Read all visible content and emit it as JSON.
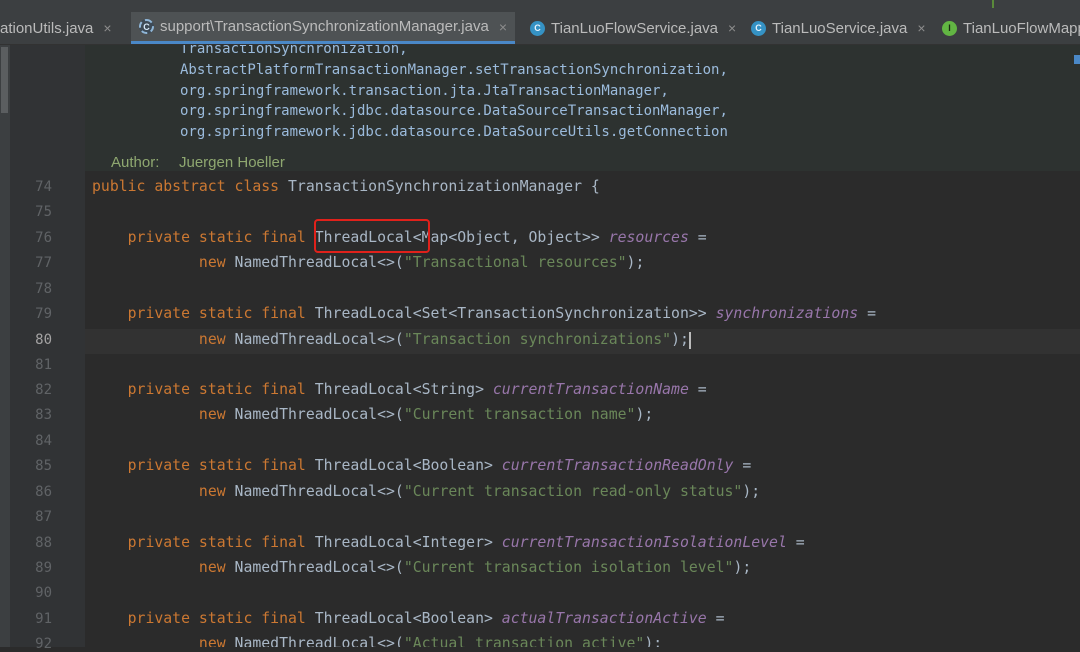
{
  "colors": {
    "keyword": "#cc7832",
    "field": "#9876aa",
    "string": "#6a8759",
    "plain": "#a9b7c6",
    "doc_link": "#9bbbdc",
    "doc_tag": "#8fa870",
    "highlight_box": "#e0211b",
    "active_tab_underline": "#4a88c7"
  },
  "tabs": [
    {
      "label": "ationUtils.java",
      "icon": "java-class-icon",
      "active": false
    },
    {
      "label": "support\\TransactionSynchronizationManager.java",
      "icon": "abstract-class-icon",
      "active": true
    },
    {
      "label": "TianLuoFlowService.java",
      "icon": "java-class-icon",
      "active": false
    },
    {
      "label": "TianLuoService.java",
      "icon": "java-class-icon",
      "active": false
    },
    {
      "label": "TianLuoFlowMapp",
      "icon": "interface-icon",
      "active": false
    }
  ],
  "tab_icon_letters": {
    "class": "C",
    "interface": "I"
  },
  "close_glyph": "×",
  "doc": {
    "lines": [
      "TransactionSynchronization,",
      "AbstractPlatformTransactionManager.setTransactionSynchronization,",
      "org.springframework.transaction.jta.JtaTransactionManager,",
      "org.springframework.jdbc.datasource.DataSourceTransactionManager,",
      "org.springframework.jdbc.datasource.DataSourceUtils.getConnection"
    ],
    "author_label": "Author:",
    "author_value": "Juergen Hoeller"
  },
  "current_line": "80",
  "code": [
    {
      "n": "74",
      "tokens": [
        [
          "kw",
          "public abstract class "
        ],
        [
          "p",
          "TransactionSynchronizationManager {"
        ]
      ]
    },
    {
      "n": "75",
      "tokens": []
    },
    {
      "n": "76",
      "tokens": [
        [
          "p",
          "    "
        ],
        [
          "kw",
          "private static final "
        ],
        [
          "p",
          "ThreadLocal<Map<Object, Object>> "
        ],
        [
          "fld",
          "resources"
        ],
        [
          "p",
          " ="
        ]
      ]
    },
    {
      "n": "77",
      "tokens": [
        [
          "p",
          "            "
        ],
        [
          "kw",
          "new "
        ],
        [
          "p",
          "NamedThreadLocal<>("
        ],
        [
          "str",
          "\"Transactional resources\""
        ],
        [
          "p",
          ");"
        ]
      ]
    },
    {
      "n": "78",
      "tokens": []
    },
    {
      "n": "79",
      "tokens": [
        [
          "p",
          "    "
        ],
        [
          "kw",
          "private static final "
        ],
        [
          "p",
          "ThreadLocal<Set<TransactionSynchronization>> "
        ],
        [
          "fld",
          "synchronizations"
        ],
        [
          "p",
          " ="
        ]
      ]
    },
    {
      "n": "80",
      "tokens": [
        [
          "p",
          "            "
        ],
        [
          "kw",
          "new "
        ],
        [
          "p",
          "NamedThreadLocal<>("
        ],
        [
          "str",
          "\"Transaction synchronizations\""
        ],
        [
          "p",
          ");"
        ]
      ]
    },
    {
      "n": "81",
      "tokens": []
    },
    {
      "n": "82",
      "tokens": [
        [
          "p",
          "    "
        ],
        [
          "kw",
          "private static final "
        ],
        [
          "p",
          "ThreadLocal<String> "
        ],
        [
          "fld",
          "currentTransactionName"
        ],
        [
          "p",
          " ="
        ]
      ]
    },
    {
      "n": "83",
      "tokens": [
        [
          "p",
          "            "
        ],
        [
          "kw",
          "new "
        ],
        [
          "p",
          "NamedThreadLocal<>("
        ],
        [
          "str",
          "\"Current transaction name\""
        ],
        [
          "p",
          ");"
        ]
      ]
    },
    {
      "n": "84",
      "tokens": []
    },
    {
      "n": "85",
      "tokens": [
        [
          "p",
          "    "
        ],
        [
          "kw",
          "private static final "
        ],
        [
          "p",
          "ThreadLocal<Boolean> "
        ],
        [
          "fld",
          "currentTransactionReadOnly"
        ],
        [
          "p",
          " ="
        ]
      ]
    },
    {
      "n": "86",
      "tokens": [
        [
          "p",
          "            "
        ],
        [
          "kw",
          "new "
        ],
        [
          "p",
          "NamedThreadLocal<>("
        ],
        [
          "str",
          "\"Current transaction read-only status\""
        ],
        [
          "p",
          ");"
        ]
      ]
    },
    {
      "n": "87",
      "tokens": []
    },
    {
      "n": "88",
      "tokens": [
        [
          "p",
          "    "
        ],
        [
          "kw",
          "private static final "
        ],
        [
          "p",
          "ThreadLocal<Integer> "
        ],
        [
          "fld",
          "currentTransactionIsolationLevel"
        ],
        [
          "p",
          " ="
        ]
      ]
    },
    {
      "n": "89",
      "tokens": [
        [
          "p",
          "            "
        ],
        [
          "kw",
          "new "
        ],
        [
          "p",
          "NamedThreadLocal<>("
        ],
        [
          "str",
          "\"Current transaction isolation level\""
        ],
        [
          "p",
          ");"
        ]
      ]
    },
    {
      "n": "90",
      "tokens": []
    },
    {
      "n": "91",
      "tokens": [
        [
          "p",
          "    "
        ],
        [
          "kw",
          "private static final "
        ],
        [
          "p",
          "ThreadLocal<Boolean> "
        ],
        [
          "fld",
          "actualTransactionActive"
        ],
        [
          "p",
          " ="
        ]
      ]
    },
    {
      "n": "92",
      "tokens": [
        [
          "p",
          "            "
        ],
        [
          "kw",
          "new "
        ],
        [
          "p",
          "NamedThreadLocal<>("
        ],
        [
          "str",
          "\"Actual transaction active\""
        ],
        [
          "p",
          ");"
        ]
      ]
    }
  ]
}
